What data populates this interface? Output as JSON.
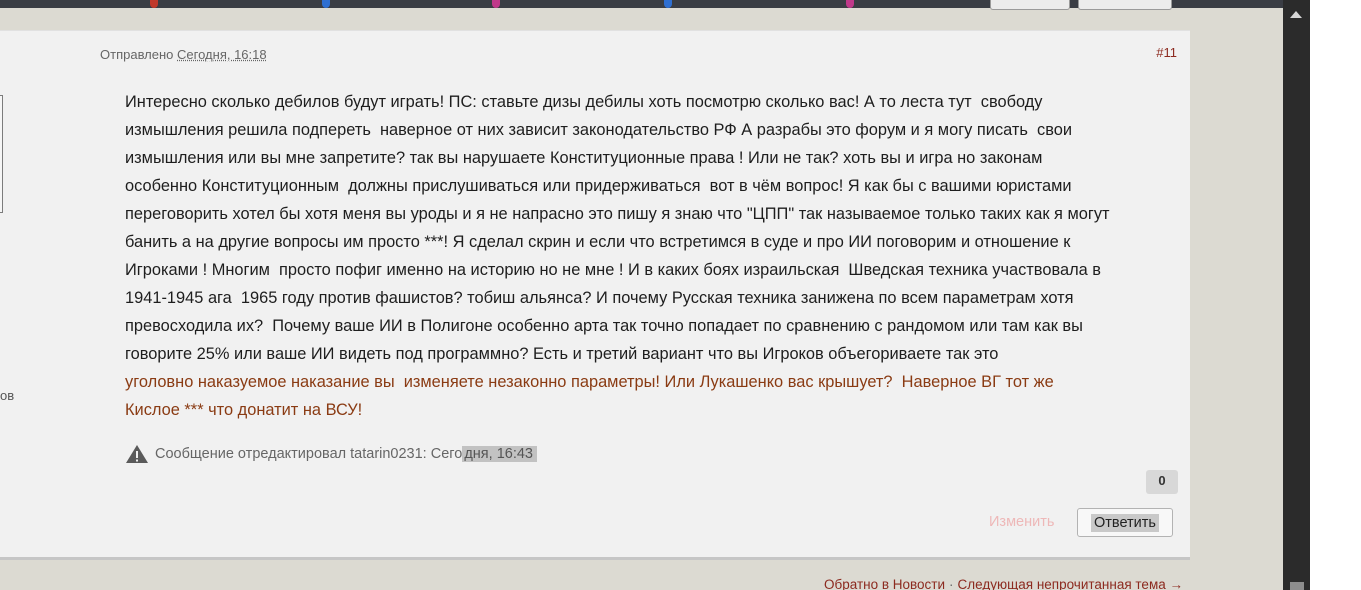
{
  "post": {
    "sent_label": "Отправлено",
    "date": "Сегодня, 16:18",
    "number": "#11",
    "body_lines": [
      "Интересно сколько дебилов будут играть! ПС: ставьте дизы дебилы хоть посмотрю сколько вас! А то леста тут  свободу",
      "измышления решила подпереть  наверное от них зависит законодательство РФ А разрабы это форум и я могу писать  свои",
      "измышления или вы мне запретите? так вы нарушаете Конституционные права ! Или не так? хоть вы и игра но законам",
      "особенно Конституционным  должны прислушиваться или придерживаться  вот в чём вопрос! Я как бы с вашими юристами",
      "переговорить хотел бы хотя меня вы уроды и я не напрасно это пишу я знаю что \"ЦПП\" так называемое только таких как я могут",
      "банить а на другие вопросы им просто ***! Я сделал скрин и если что встретимся в суде и про ИИ поговорим и отношение к",
      "Игроками ! Многим  просто пофиг именно на историю но не мне ! И в каких боях израильская  Шведская техника участвовала в",
      "1941-1945 ага  1965 году против фашистов? тобиш альянса? И почему Русская техника занижена по всем параметрам хотя",
      "превосходила их?  Почему ваше ИИ в Полигоне особенно арта так точно попадает по сравнению с рандомом или там как вы",
      "говорите 25% или ваше ИИ видеть под программно? Есть и третий вариант что вы Игроков объегориваете так это"
    ],
    "colored_lines": [
      "уголовно наказуемое наказание вы  изменяете незаконно параметры! Или Лукашенко вас крышует?  Наверное ВГ тот же",
      "Кислое *** что донатит на ВСУ!"
    ],
    "edit_note_prefix": "Сообщение отредактировал tatarin0231: Сего",
    "edit_note_highlight": "дня, 16:43",
    "reputation": "0",
    "edit_label": "Изменить",
    "reply_label": "Ответить"
  },
  "sidebar": {
    "stats_fragment": "ов"
  },
  "footer": {
    "back_link": "Обратно в Новости",
    "separator": "·",
    "next_link": "Следующая непрочитанная тема →"
  },
  "colors": {
    "accent": "#8c2a1f",
    "colored_text": "#8a3b13",
    "panel": "#f1f1f1",
    "background": "#dcdad2"
  }
}
